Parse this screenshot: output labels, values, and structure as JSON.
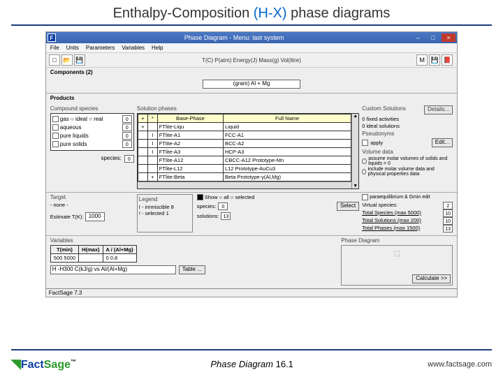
{
  "slide": {
    "title_prefix": "Enthalpy-Composition ",
    "title_hx": "(H-X)",
    "title_suffix": " phase diagrams"
  },
  "window": {
    "title": "Phase Diagram - Menu: last system",
    "menu": [
      "File",
      "Units",
      "Parameters",
      "Variables",
      "Help"
    ],
    "toolbar_center": "T(C)  P(atm)  Energy(J)  Mass(g)  Vol(litre)",
    "components_label": "Components (2)",
    "comp_field": "(gram)  Al  +  Mg",
    "products_label": "Products"
  },
  "compound": {
    "title": "Compound species",
    "rows": [
      {
        "label": "gas ○ ideal ○ real",
        "num": "0"
      },
      {
        "label": "aqueous",
        "num": "0"
      },
      {
        "label": "pure liquids",
        "num": "0"
      },
      {
        "label": "pure solids",
        "num": "0"
      }
    ],
    "species_label": "species:",
    "species_num": "0"
  },
  "solution": {
    "title": "Solution phases",
    "headers": {
      "pm1": "+",
      "pm2": "*",
      "base": "Base-Phase",
      "full": "Full Name"
    },
    "rows": [
      {
        "a": "+",
        "b": "",
        "base": "FTlite-Liqu",
        "full": "Liquid"
      },
      {
        "a": "",
        "b": "I",
        "base": "FTlite-A1",
        "full": "FCC-A1"
      },
      {
        "a": "",
        "b": "I",
        "base": "FTlite-A2",
        "full": "BCC-A2"
      },
      {
        "a": "",
        "b": "I",
        "base": "FTlite-A3",
        "full": "HCP-A3"
      },
      {
        "a": "",
        "b": "",
        "base": "FTlite-A12",
        "full": "CBCC-A12 Prototype-Mn"
      },
      {
        "a": "",
        "b": "",
        "base": "FTlite-L12",
        "full": "L12 Prototype-AuCu3"
      },
      {
        "a": "",
        "b": "+",
        "base": "FTlite-Beta",
        "full": "Beta Prototype-γ(Al,Mg)"
      }
    ]
  },
  "custom": {
    "title": "Custom Solutions",
    "lines": [
      "0 fixed activities",
      "0 ideal solutions"
    ],
    "details_btn": "Details...",
    "pseudonyms": "Pseudonyms",
    "apply": "apply",
    "edit_btn": "Edit...",
    "volume_title": "Volume data",
    "vol_lines": [
      "assume molar volumes of solids and liquids = 0",
      "include molar volume data and physical properties data"
    ],
    "paraequil": "paraequilibrium & Gmin   edit",
    "virtual_label": "Virtual species:",
    "virtual_num": "2",
    "totals": [
      {
        "label": "Total Species (max 5000)",
        "val": "10"
      },
      {
        "label": "Total Solutions (max 200)",
        "val": "10"
      },
      {
        "label": "Total Phases (max 1500)",
        "val": "13"
      }
    ]
  },
  "target": {
    "title": "Target",
    "none": "- none -",
    "est_label": "Estimate T(K):",
    "est_val": "1000"
  },
  "legend": {
    "title": "Legend",
    "lines": [
      "I - immiscible 8",
      "! - selected 1"
    ],
    "show_all": "Show ○ all  ○ selected",
    "species_label": "species:",
    "species_num": "0",
    "solutions_label": "solutions:",
    "solutions_num": "13",
    "select_btn": "Select"
  },
  "vars": {
    "title": "Variables",
    "headers": [
      "T(min)",
      "H(max)",
      "A / (Al+Mg)"
    ],
    "row": [
      "500  5000",
      "",
      "0  0.8"
    ],
    "axis_label": "H  -H300 C(kJ/g) vs  Al/(Al+Mg)",
    "table_btn": "Table ..."
  },
  "phase_diagram": {
    "title": "Phase Diagram",
    "btn": "Calculate >>"
  },
  "status": "FactSage 7.3",
  "footer": {
    "center_label": "Phase Diagram",
    "center_num": "  16.1",
    "url": "www.factsage.com"
  }
}
